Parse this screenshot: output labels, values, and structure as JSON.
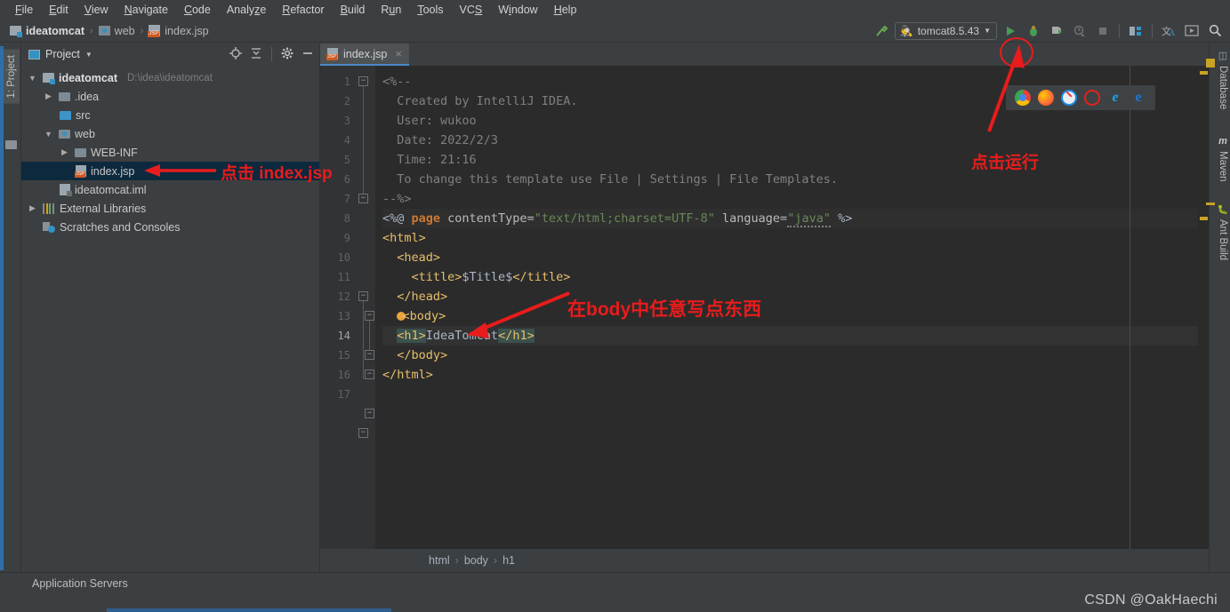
{
  "menu": {
    "items": [
      {
        "label": "File",
        "mnemonic": "F"
      },
      {
        "label": "Edit",
        "mnemonic": "E"
      },
      {
        "label": "View",
        "mnemonic": "V"
      },
      {
        "label": "Navigate",
        "mnemonic": "N"
      },
      {
        "label": "Code",
        "mnemonic": "C"
      },
      {
        "label": "Analyze",
        "mnemonic": "z"
      },
      {
        "label": "Refactor",
        "mnemonic": "R"
      },
      {
        "label": "Build",
        "mnemonic": "B"
      },
      {
        "label": "Run",
        "mnemonic": "n"
      },
      {
        "label": "Tools",
        "mnemonic": "T"
      },
      {
        "label": "VCS",
        "mnemonic": "S"
      },
      {
        "label": "Window",
        "mnemonic": "W"
      },
      {
        "label": "Help",
        "mnemonic": "H"
      }
    ]
  },
  "navbar": {
    "crumbs": [
      "ideatomcat",
      "web",
      "index.jsp"
    ],
    "separator": "›",
    "run_config": "tomcat8.5.43",
    "icons": [
      "build-hammer-icon",
      "run-icon",
      "debug-icon",
      "run-with-coverage-icon",
      "profile-icon",
      "stop-icon",
      "project-structure-icon",
      "translate-icon",
      "presentation-icon",
      "search-everywhere-icon"
    ]
  },
  "left_strip": {
    "tab": "1: Project",
    "folder_icon": "folder-icon"
  },
  "project_panel": {
    "title": "Project",
    "header_icons": [
      "locate-target-icon",
      "collapse-all-icon",
      "settings-gear-icon",
      "hide-minimize-icon"
    ],
    "tree": [
      {
        "label": "ideatomcat",
        "path": "D:\\idea\\ideatomcat",
        "twisty": "▼",
        "icon": "module-icon",
        "indent": 0,
        "bold": true,
        "selected": false
      },
      {
        "label": ".idea",
        "path": "",
        "twisty": "▶",
        "icon": "folder-icon",
        "indent": 1,
        "bold": false,
        "selected": false
      },
      {
        "label": "src",
        "path": "",
        "twisty": "",
        "icon": "source-folder-icon",
        "indent": 1,
        "bold": false,
        "selected": false
      },
      {
        "label": "web",
        "path": "",
        "twisty": "▼",
        "icon": "web-folder-icon",
        "indent": 1,
        "bold": false,
        "selected": false
      },
      {
        "label": "WEB-INF",
        "path": "",
        "twisty": "▶",
        "icon": "folder-icon",
        "indent": 2,
        "bold": false,
        "selected": false
      },
      {
        "label": "index.jsp",
        "path": "",
        "twisty": "",
        "icon": "jsp-file-icon",
        "indent": 2,
        "bold": false,
        "selected": true
      },
      {
        "label": "ideatomcat.iml",
        "path": "",
        "twisty": "",
        "icon": "iml-file-icon",
        "indent": 1,
        "bold": false,
        "selected": false
      },
      {
        "label": "External Libraries",
        "path": "",
        "twisty": "▶",
        "icon": "libraries-icon",
        "indent": 0,
        "bold": false,
        "selected": false
      },
      {
        "label": "Scratches and Consoles",
        "path": "",
        "twisty": "",
        "icon": "scratches-icon",
        "indent": 0,
        "bold": false,
        "selected": false
      }
    ]
  },
  "editor": {
    "tab": {
      "label": "index.jsp",
      "icon": "jsp-file-icon",
      "close": "×"
    },
    "line_count": 17,
    "current_line": 14,
    "lines": [
      {
        "n": 1,
        "text": "<%--"
      },
      {
        "n": 2,
        "text": "  Created by IntelliJ IDEA."
      },
      {
        "n": 3,
        "text": "  User: wukoo"
      },
      {
        "n": 4,
        "text": "  Date: 2022/2/3"
      },
      {
        "n": 5,
        "text": "  Time: 21:16"
      },
      {
        "n": 6,
        "text": "  To change this template use File | Settings | File Templates."
      },
      {
        "n": 7,
        "text": "--%>"
      },
      {
        "n": 8,
        "text": "<%@ page contentType=\"text/html;charset=UTF-8\" language=\"java\" %>"
      },
      {
        "n": 9,
        "text": "<html>"
      },
      {
        "n": 10,
        "text": "  <head>"
      },
      {
        "n": 11,
        "text": "    <title>$Title$</title>"
      },
      {
        "n": 12,
        "text": "  </head>"
      },
      {
        "n": 13,
        "text": "  <body>"
      },
      {
        "n": 14,
        "text": "  <h1>IdeaTomcat</h1>"
      },
      {
        "n": 15,
        "text": "  </body>"
      },
      {
        "n": 16,
        "text": "</html>"
      },
      {
        "n": 17,
        "text": ""
      }
    ],
    "code_parts": {
      "l8_open": "<%@ ",
      "l8_kw": "page",
      "l8_attr1": " contentType=",
      "l8_str1": "\"text/html;charset=UTF-8\"",
      "l8_attr2": " language=",
      "l8_str2": "\"java\"",
      "l8_close": " %>",
      "l11_open": "<title>",
      "l11_val": "$Title$",
      "l11_close": "</title>",
      "l14_open": "<h1>",
      "l14_val": "IdeaTomcat",
      "l14_close": "</h1>"
    },
    "browsers": [
      "chrome-icon",
      "firefox-icon",
      "safari-icon",
      "opera-icon",
      "ie-icon",
      "edge-icon"
    ],
    "breadcrumb": [
      "html",
      "body",
      "h1"
    ],
    "breadcrumb_separator": "›"
  },
  "right_strip": {
    "tabs": [
      {
        "label": "Database",
        "icon": "database-icon"
      },
      {
        "label": "Maven",
        "icon": "maven-icon"
      },
      {
        "label": "Ant Build",
        "icon": "ant-icon"
      }
    ]
  },
  "bottom": {
    "tool_window": "Application Servers"
  },
  "annotations": [
    {
      "id": "click-index-jsp",
      "text": "点击 index.jsp"
    },
    {
      "id": "write-in-body",
      "text": "在body中任意写点东西"
    },
    {
      "id": "click-run",
      "text": "点击运行"
    }
  ],
  "watermark": "CSDN @OakHaechi",
  "colors": {
    "accent_red": "#e81c1c",
    "editor_bg": "#2b2b2b",
    "panel_bg": "#3c3f41",
    "selection_blue": "#0d293e",
    "tab_underline": "#4a88c7",
    "run_green": "#499c54"
  }
}
